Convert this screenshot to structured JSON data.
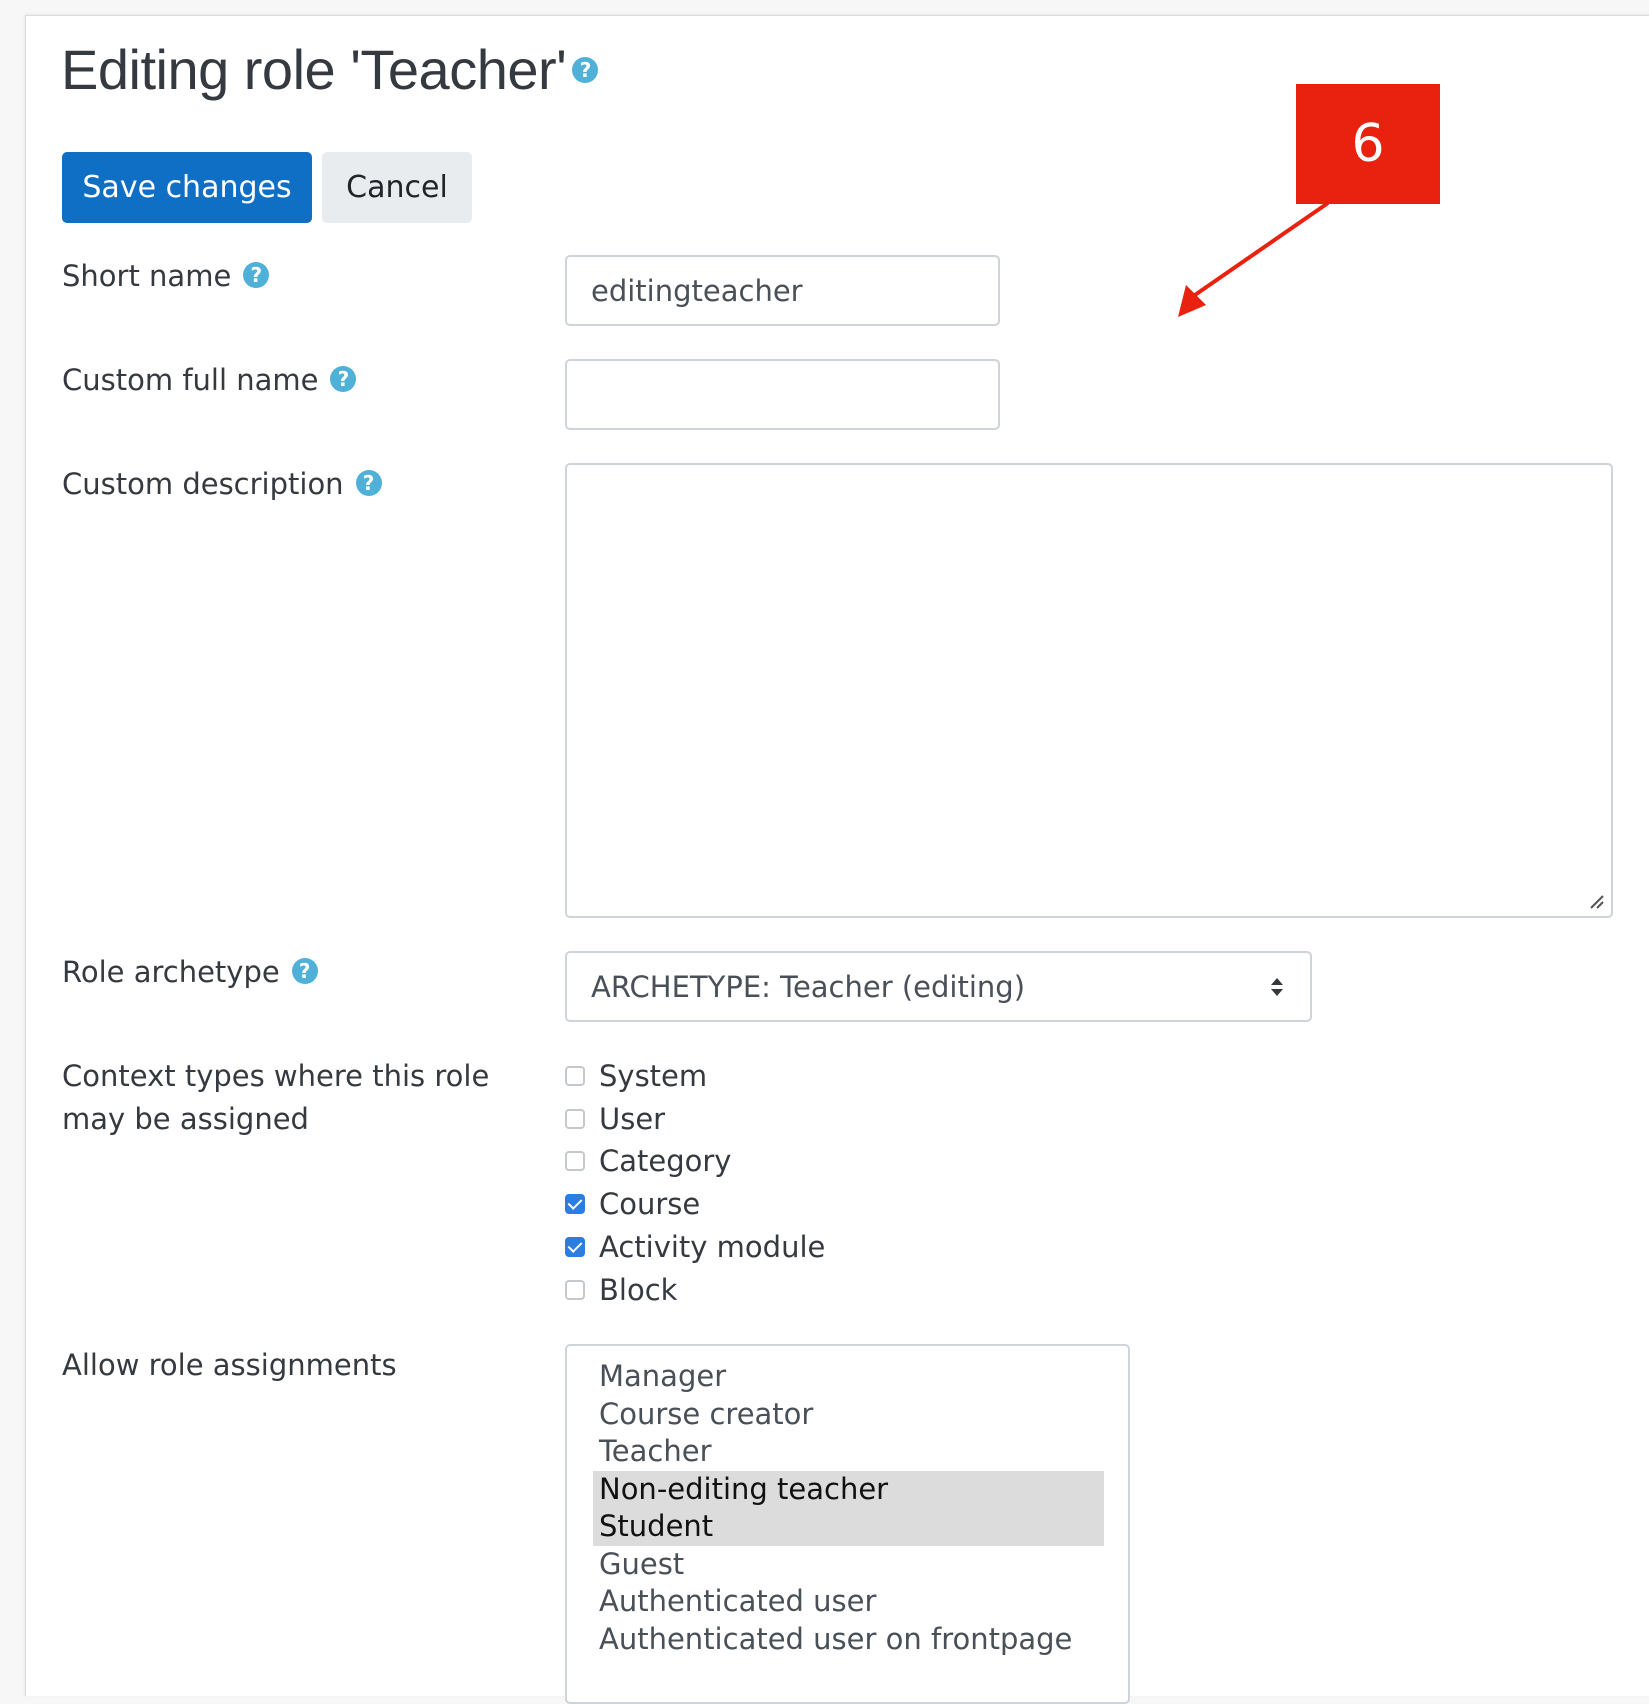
{
  "page": {
    "title": "Editing role 'Teacher'",
    "title_help_icon": "question-circle-icon"
  },
  "buttons": {
    "save_label": "Save changes",
    "cancel_label": "Cancel"
  },
  "form": {
    "short_name": {
      "label": "Short name",
      "value": "editingteacher"
    },
    "custom_full_name": {
      "label": "Custom full name",
      "value": ""
    },
    "custom_description": {
      "label": "Custom description",
      "value": ""
    },
    "role_archetype": {
      "label": "Role archetype",
      "selected": "ARCHETYPE: Teacher (editing)"
    },
    "context_types": {
      "label_line1": "Context types where this role",
      "label_line2": "may be assigned",
      "options": [
        {
          "label": "System",
          "checked": false
        },
        {
          "label": "User",
          "checked": false
        },
        {
          "label": "Category",
          "checked": false
        },
        {
          "label": "Course",
          "checked": true
        },
        {
          "label": "Activity module",
          "checked": true
        },
        {
          "label": "Block",
          "checked": false
        }
      ]
    },
    "allow_role_assignments": {
      "label": "Allow role assignments",
      "options": [
        {
          "label": "Manager",
          "selected": false
        },
        {
          "label": "Course creator",
          "selected": false
        },
        {
          "label": "Teacher",
          "selected": false
        },
        {
          "label": "Non-editing teacher",
          "selected": true
        },
        {
          "label": "Student",
          "selected": true
        },
        {
          "label": "Guest",
          "selected": false
        },
        {
          "label": "Authenticated user",
          "selected": false
        },
        {
          "label": "Authenticated user on frontpage",
          "selected": false
        }
      ]
    }
  },
  "annotation": {
    "callout_number": "6",
    "color": "#e8220f"
  },
  "colors": {
    "primary": "#0f6fc5",
    "help_icon": "#4fb1d8",
    "checkbox_checked": "#2a7de1",
    "selected_option_bg": "#dcdcdc"
  }
}
